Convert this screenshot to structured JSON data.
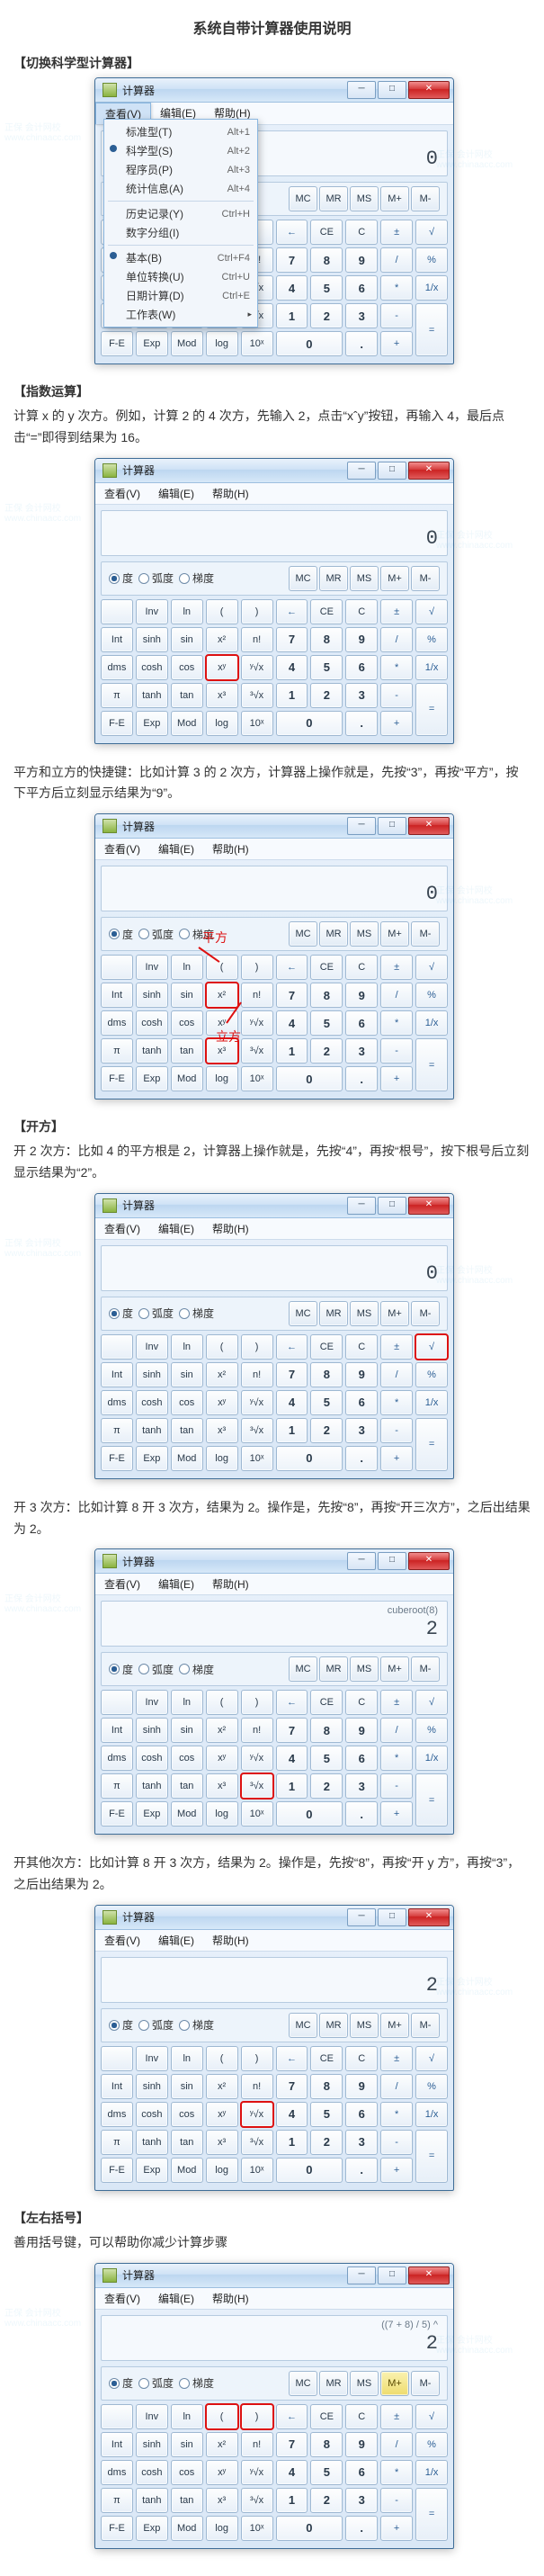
{
  "page_title": "系统自带计算器使用说明",
  "brand_watermark": "正保 会计网校 www.chinaacc.com",
  "sections": {
    "switch": {
      "heading": "【切换科学型计算器】"
    },
    "exponent": {
      "heading": "【指数运算】",
      "p1": "计算 x 的 y 次方。例如，计算 2 的 4 次方，先输入 2，点击“xˆy”按钮，再输入 4，最后点击“=”即得到结果为 16。",
      "p2": "平方和立方的快捷键：比如计算 3 的 2 次方，计算器上操作就是，先按“3”，再按“平方”，按下平方后立刻显示结果为“9”。",
      "anno_square": "平方",
      "anno_cube": "立方"
    },
    "root": {
      "heading": "【开方】",
      "p1": "开 2 次方：比如 4 的平方根是 2，计算器上操作就是，先按“4”，再按“根号”，按下根号后立刻显示结果为“2”。",
      "p2": "开 3 次方：比如计算 8 开 3 次方，结果为 2。操作是，先按“8”，再按“开三次方”，之后出结果为 2。",
      "p3": "开其他次方：比如计算 8 开 3 次方，结果为 2。操作是，先按“8”，再按“开 y 方”，再按“3”，之后出结果为 2。"
    },
    "paren": {
      "heading": "【左右括号】",
      "p1": "善用括号键，可以帮助你减少计算步骤"
    }
  },
  "calc_common": {
    "title": "计算器",
    "menus": {
      "view": "查看(V)",
      "edit": "编辑(E)",
      "help": "帮助(H)"
    },
    "win_btns": {
      "min": "─",
      "max": "□",
      "close": "✕"
    },
    "modes": {
      "deg": "度",
      "rad": "弧度",
      "grad": "梯度"
    },
    "mem": {
      "mc": "MC",
      "mr": "MR",
      "ms": "MS",
      "mplus": "M+",
      "mminus": "M-"
    },
    "rows": {
      "r1": [
        "",
        "Inv",
        "ln",
        "(",
        ")",
        "←",
        "CE",
        "C",
        "±",
        "√"
      ],
      "r2": [
        "Int",
        "sinh",
        "sin",
        "x²",
        "n!",
        "7",
        "8",
        "9",
        "/",
        "%"
      ],
      "r3": [
        "dms",
        "cosh",
        "cos",
        "xʸ",
        "ʸ√x",
        "4",
        "5",
        "6",
        "*",
        "1/x"
      ],
      "r4": [
        "π",
        "tanh",
        "tan",
        "x³",
        "³√x",
        "1",
        "2",
        "3",
        "-",
        "="
      ],
      "r5": [
        "F-E",
        "Exp",
        "Mod",
        "log",
        "10ˣ",
        "0",
        "",
        ".",
        "+",
        ""
      ]
    }
  },
  "dropdown_items": [
    {
      "label": "标准型(T)",
      "shortcut": "Alt+1"
    },
    {
      "label": "科学型(S)",
      "shortcut": "Alt+2",
      "radio": true
    },
    {
      "label": "程序员(P)",
      "shortcut": "Alt+3"
    },
    {
      "label": "统计信息(A)",
      "shortcut": "Alt+4"
    },
    {
      "sep": true
    },
    {
      "label": "历史记录(Y)",
      "shortcut": "Ctrl+H"
    },
    {
      "label": "数字分组(I)"
    },
    {
      "sep": true
    },
    {
      "label": "基本(B)",
      "shortcut": "Ctrl+F4",
      "radio": true
    },
    {
      "label": "单位转换(U)",
      "shortcut": "Ctrl+U"
    },
    {
      "label": "日期计算(D)",
      "shortcut": "Ctrl+E"
    },
    {
      "label": "工作表(W)",
      "arrow": true
    }
  ],
  "displays": {
    "c1": {
      "history": "",
      "value": "0"
    },
    "c2": {
      "history": "",
      "value": "0"
    },
    "c3": {
      "history": "",
      "value": "0"
    },
    "c4": {
      "history": "",
      "value": "0"
    },
    "c5": {
      "history": "cuberoot(8)",
      "value": "2"
    },
    "c6": {
      "history": "",
      "value": "2"
    },
    "c7": {
      "history": "((7 + 8) / 5) ^",
      "value": "2"
    }
  }
}
